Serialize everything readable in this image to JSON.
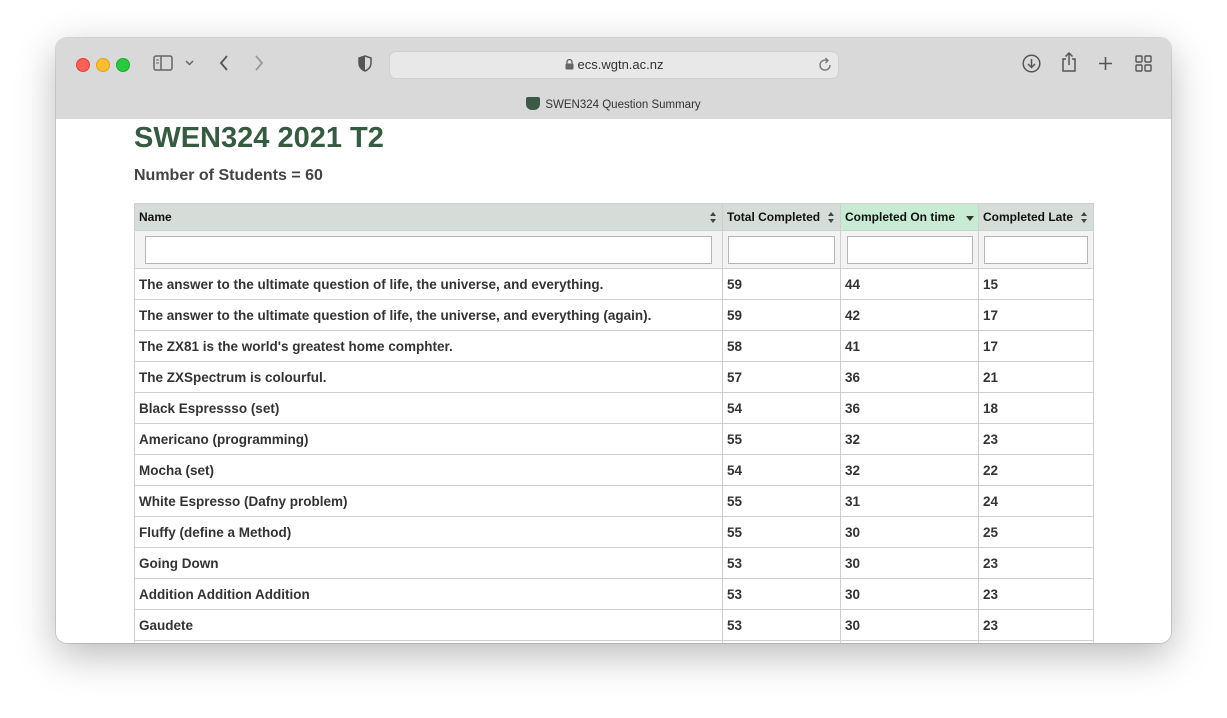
{
  "browser": {
    "url": "ecs.wgtn.ac.nz",
    "tab_title": "SWEN324 Question Summary"
  },
  "page": {
    "title": "SWEN324 2021 T2",
    "subtitle": "Number of Students = 60"
  },
  "table": {
    "columns": [
      "Name",
      "Total Completed",
      "Completed On time",
      "Completed Late"
    ],
    "sorted_column": "Completed On time",
    "sort_direction": "descending",
    "rows": [
      {
        "name": "The answer to the ultimate question of life, the universe, and everything.",
        "total": "59",
        "on_time": "44",
        "late": "15"
      },
      {
        "name": "The answer to the ultimate question of life, the universe, and everything (again).",
        "total": "59",
        "on_time": "42",
        "late": "17"
      },
      {
        "name": "The ZX81 is the world's greatest home comphter.",
        "total": "58",
        "on_time": "41",
        "late": "17"
      },
      {
        "name": "The ZXSpectrum is colourful.",
        "total": "57",
        "on_time": "36",
        "late": "21"
      },
      {
        "name": "Black Espressso (set)",
        "total": "54",
        "on_time": "36",
        "late": "18"
      },
      {
        "name": "Americano (programming)",
        "total": "55",
        "on_time": "32",
        "late": "23"
      },
      {
        "name": "Mocha (set)",
        "total": "54",
        "on_time": "32",
        "late": "22"
      },
      {
        "name": "White Espresso (Dafny problem)",
        "total": "55",
        "on_time": "31",
        "late": "24"
      },
      {
        "name": "Fluffy (define a Method)",
        "total": "55",
        "on_time": "30",
        "late": "25"
      },
      {
        "name": "Going Down",
        "total": "53",
        "on_time": "30",
        "late": "23"
      },
      {
        "name": "Addition Addition Addition",
        "total": "53",
        "on_time": "30",
        "late": "23"
      },
      {
        "name": "Gaudete",
        "total": "53",
        "on_time": "30",
        "late": "23"
      },
      {
        "name": "",
        "total": "",
        "on_time": "",
        "late": ""
      }
    ]
  },
  "colors": {
    "heading": "#375a43",
    "header_bg": "#d6ddd8",
    "sorted_header_bg": "#c8ecd3"
  },
  "icons": [
    "close-button",
    "minimize-button",
    "maximize-button",
    "sidebar-icon",
    "chevron-down-icon",
    "back-icon",
    "forward-icon",
    "privacy-shield-icon",
    "lock-icon",
    "reload-icon",
    "download-icon",
    "share-icon",
    "new-tab-icon",
    "tab-overview-icon"
  ]
}
